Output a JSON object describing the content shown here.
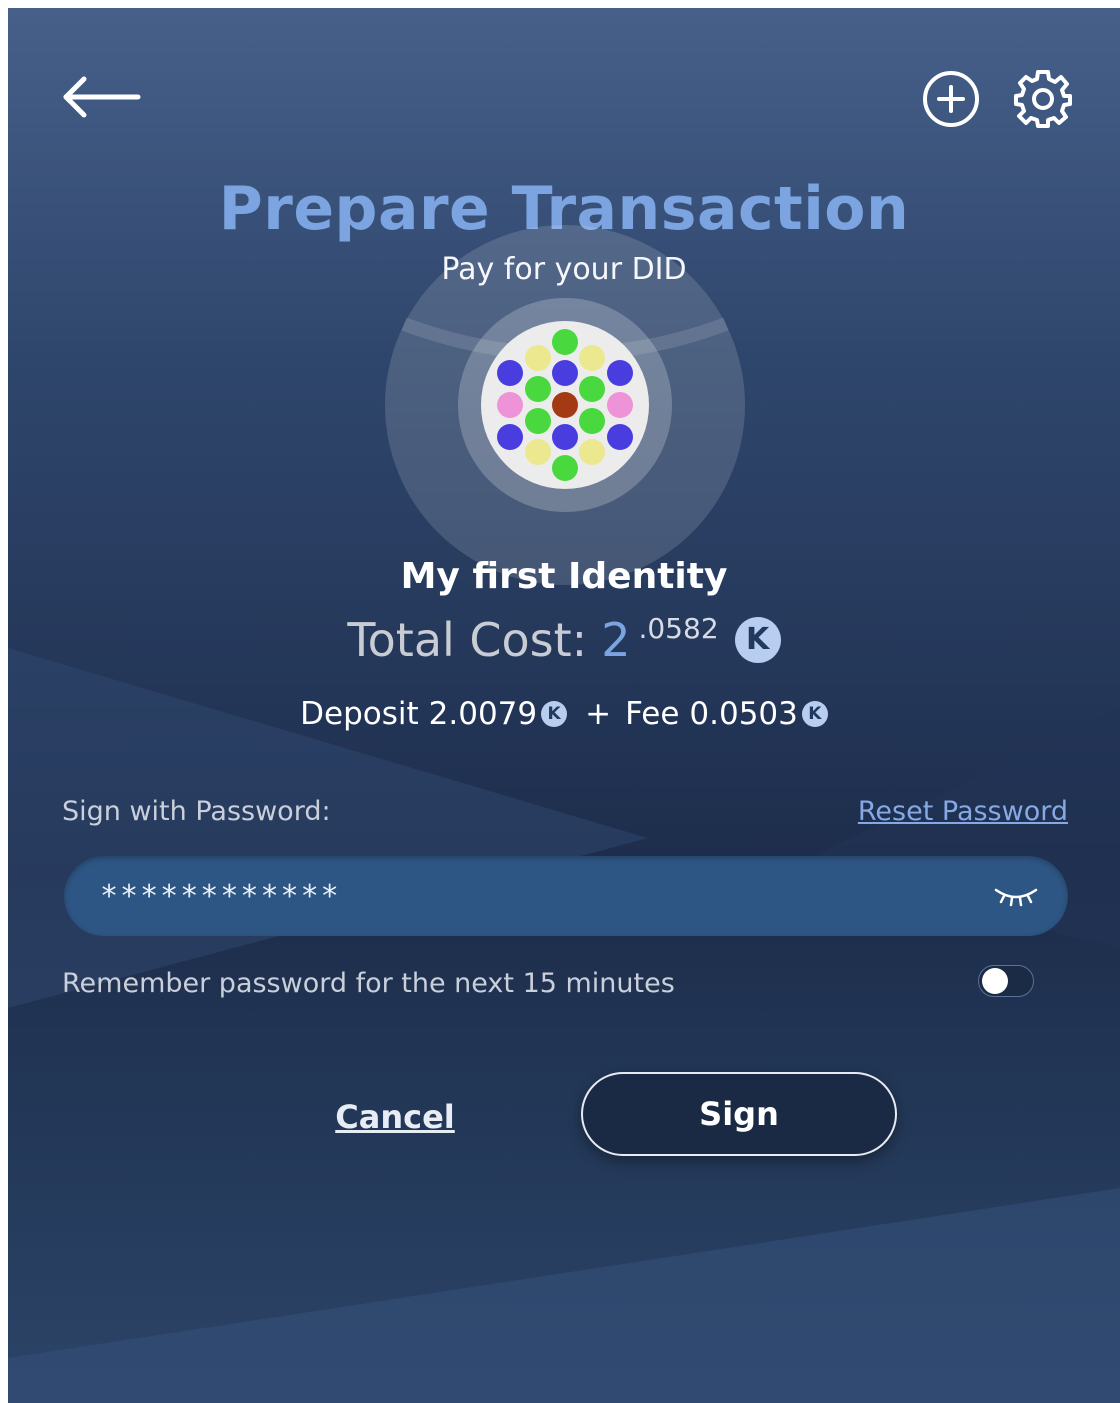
{
  "header": {
    "back_icon": "arrow-left-icon",
    "add_icon": "plus-circle-icon",
    "settings_icon": "gear-icon"
  },
  "page": {
    "title": "Prepare Transaction",
    "subtitle": "Pay for your DID"
  },
  "identity": {
    "name": "My first Identity",
    "avatar_colors": [
      "#49d93e",
      "#ece88f",
      "#4a3de0",
      "#ef93d9",
      "#a33a14",
      "#ececec"
    ]
  },
  "cost": {
    "label": "Total Cost:",
    "integer": "2",
    "decimal": ".0582",
    "deposit_label": "Deposit",
    "deposit_value": "2.0079",
    "plus": "+",
    "fee_label": "Fee",
    "fee_value": "0.0503",
    "currency_icon": "kilt-coin-icon",
    "currency_glyph": "K"
  },
  "password": {
    "label": "Sign with Password:",
    "reset_link": "Reset Password",
    "value": "************",
    "visibility_icon": "eye-closed-icon"
  },
  "remember": {
    "label": "Remember password for the next 15 minutes",
    "enabled": false
  },
  "actions": {
    "cancel_label": "Cancel",
    "sign_label": "Sign"
  },
  "colors": {
    "accent": "#7ba4e0",
    "background_top": "#46608a",
    "background_bottom": "#1d2c4a",
    "input_fill": "#2e5684"
  }
}
